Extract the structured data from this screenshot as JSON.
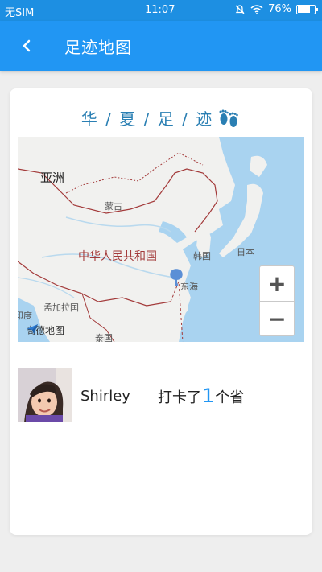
{
  "status_bar": {
    "carrier": "无SIM",
    "time": "11:07",
    "battery": "76%",
    "battery_level": 0.76
  },
  "app_bar": {
    "back_icon": "chevron-left-icon",
    "title": "足迹地图"
  },
  "card": {
    "title": "华 / 夏 / 足 / 迹",
    "title_icon": "footprints-icon",
    "map": {
      "labels": {
        "asia": "亚洲",
        "mongolia": "蒙古",
        "china": "中华人民共和国",
        "korea": "韩国",
        "japan": "日本",
        "east_sea": "东海",
        "bangladesh": "孟加拉国",
        "india": "印度",
        "thailand": "泰国"
      },
      "provider": "高德地图",
      "zoom_in": "+",
      "zoom_out": "−"
    },
    "user": {
      "name": "Shirley",
      "checkin_prefix": "打卡了",
      "checkin_count": "1",
      "checkin_suffix": "个省"
    }
  },
  "colors": {
    "primary": "#2196f3",
    "title_blue": "#2a7fb3",
    "water": "#a9d3f0",
    "land": "#f1f1ef",
    "border": "#a33a3a"
  }
}
